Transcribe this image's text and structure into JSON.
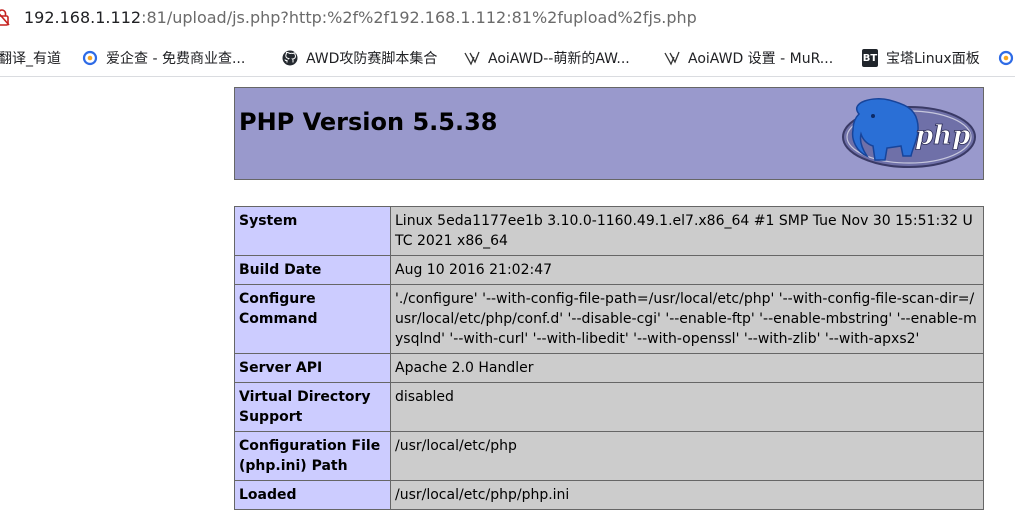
{
  "browser": {
    "url_host": "192.168.1.112",
    "url_rest": ":81/upload/js.php?http:%2f%2f192.168.1.112:81%2fupload%2fjs.php"
  },
  "bookmarks": [
    {
      "label": "翻译_有道",
      "icon": "youdao-icon"
    },
    {
      "label": "爱企查 - 免费商业查...",
      "icon": "aiqicha-icon"
    },
    {
      "label": "AWD攻防赛脚本集合",
      "icon": "github-icon"
    },
    {
      "label": "AoiAWD--萌新的AW...",
      "icon": "aoiawd-icon"
    },
    {
      "label": "AoiAWD 设置 - MuR...",
      "icon": "aoiawd-icon"
    },
    {
      "label": "宝塔Linux面板",
      "icon": "bt-icon",
      "badge": "BT"
    }
  ],
  "phpinfo": {
    "title": "PHP Version 5.5.38",
    "logo_text": "php",
    "rows": [
      {
        "key": "System",
        "value": "Linux 5eda1177ee1b 3.10.0-1160.49.1.el7.x86_64 #1 SMP Tue Nov 30 15:51:32 UTC 2021 x86_64"
      },
      {
        "key": "Build Date",
        "value": "Aug 10 2016 21:02:47"
      },
      {
        "key": "Configure Command",
        "value": "'./configure' '--with-config-file-path=/usr/local/etc/php' '--with-config-file-scan-dir=/usr/local/etc/php/conf.d' '--disable-cgi' '--enable-ftp' '--enable-mbstring' '--enable-mysqlnd' '--with-curl' '--with-libedit' '--with-openssl' '--with-zlib' '--with-apxs2'"
      },
      {
        "key": "Server API",
        "value": "Apache 2.0 Handler"
      },
      {
        "key": "Virtual Directory Support",
        "value": "disabled"
      },
      {
        "key": "Configuration File (php.ini) Path",
        "value": "/usr/local/etc/php"
      },
      {
        "key": "Loaded",
        "value": "/usr/local/etc/php/php.ini"
      }
    ]
  },
  "colors": {
    "header_bg": "#9999cc",
    "key_bg": "#ccccff",
    "value_bg": "#cccccc"
  }
}
